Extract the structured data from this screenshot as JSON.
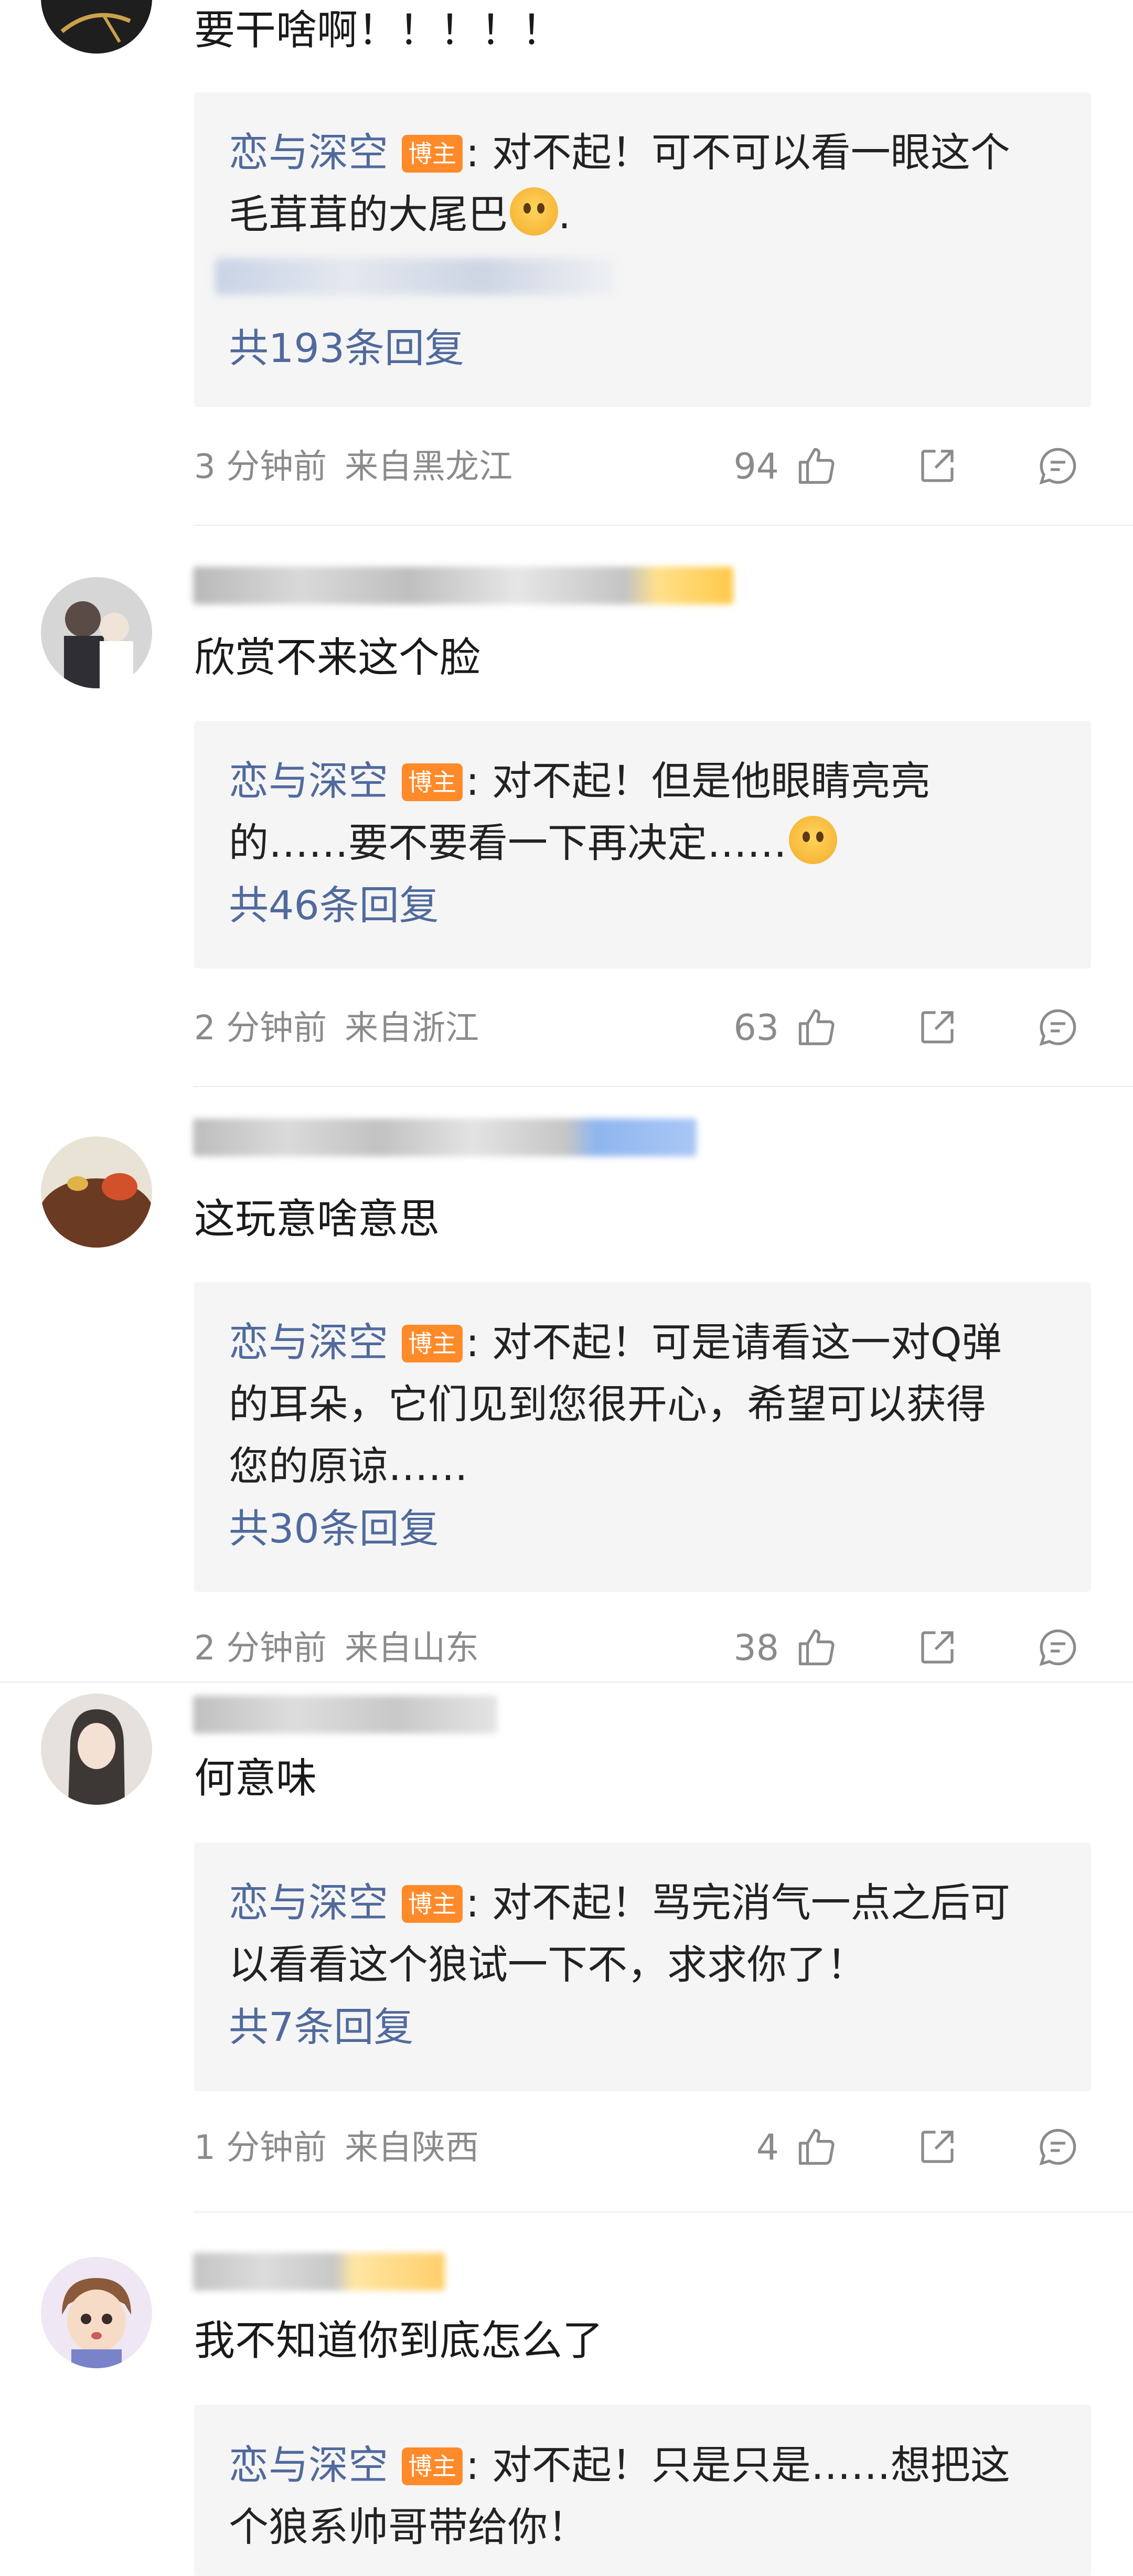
{
  "comments": [
    {
      "text": "要干啥啊！！！！！",
      "reply": {
        "author": "恋与深空",
        "badge": "博主",
        "lines": [
          ": 对不起！可不可以看一眼这个",
          "毛茸茸的大尾巴"
        ],
        "count": "共193条回复"
      },
      "time": "3 分钟前",
      "location": "来自黑龙江",
      "likes": "94",
      "avatar_color": "#2a2a2a"
    },
    {
      "text": "欣赏不来这个脸",
      "reply": {
        "author": "恋与深空",
        "badge": "博主",
        "lines": [
          ": 对不起！但是他眼睛亮亮",
          "的……要不要看一下再决定……"
        ],
        "count": "共46条回复"
      },
      "time": "2 分钟前",
      "location": "来自浙江",
      "likes": "63",
      "avatar_color": "#4a4a50"
    },
    {
      "text": "这玩意啥意思",
      "reply": {
        "author": "恋与深空",
        "badge": "博主",
        "lines": [
          ": 对不起！可是请看这一对Q弹",
          "的耳朵，它们见到您很开心，希望可以获得",
          "您的原谅……"
        ],
        "count": "共30条回复"
      },
      "time": "2 分钟前",
      "location": "来自山东",
      "likes": "38",
      "avatar_color": "#6b3a22"
    },
    {
      "text": "何意味",
      "reply": {
        "author": "恋与深空",
        "badge": "博主",
        "lines": [
          ": 对不起！骂完消气一点之后可",
          "以看看这个狼试一下不，求求你了！"
        ],
        "count": "共7条回复"
      },
      "time": "1 分钟前",
      "location": "来自陕西",
      "likes": "4",
      "avatar_color": "#d9d4cf"
    },
    {
      "text": "我不知道你到底怎么了",
      "reply": {
        "author": "恋与深空",
        "badge": "博主",
        "lines": [
          ": 对不起！只是只是……想把这",
          "个狼系帅哥带给你！"
        ]
      },
      "avatar_color": "#f1d8c6"
    }
  ],
  "icons": {
    "like": "thumbs-up-icon",
    "share": "share-icon",
    "comment": "comment-icon"
  },
  "colors": {
    "author": "#506a9d",
    "badge": "#ff8a2a",
    "meta": "#8b8b8b",
    "reply_bg": "#f5f5f5"
  }
}
